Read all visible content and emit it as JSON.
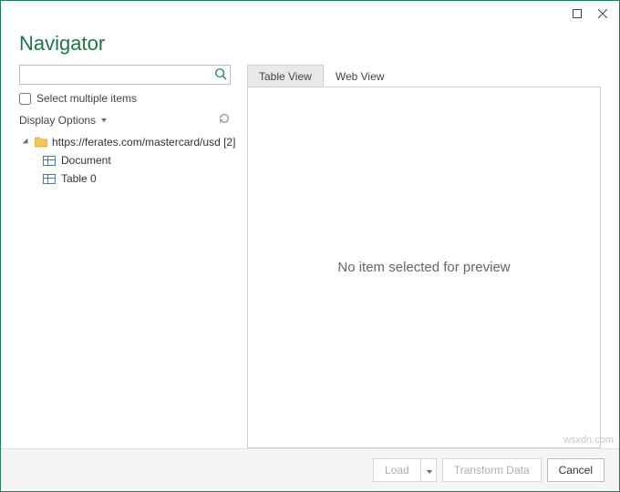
{
  "titlebar": {},
  "heading": "Navigator",
  "search": {
    "placeholder": ""
  },
  "select_multiple": {
    "label": "Select multiple items",
    "checked": false
  },
  "display_options": {
    "label": "Display Options"
  },
  "tree": {
    "root": {
      "label": "https://ferates.com/mastercard/usd [2]",
      "children": [
        {
          "label": "Document"
        },
        {
          "label": "Table 0"
        }
      ]
    }
  },
  "tabs": [
    {
      "label": "Table View",
      "active": true
    },
    {
      "label": "Web View",
      "active": false
    }
  ],
  "preview": {
    "message": "No item selected for preview"
  },
  "footer": {
    "load": "Load",
    "transform": "Transform Data",
    "cancel": "Cancel"
  },
  "watermark": "wsxdn.com"
}
